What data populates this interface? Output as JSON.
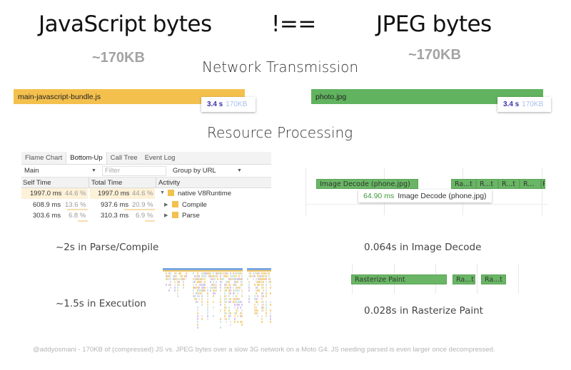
{
  "headings": {
    "left_title": "JavaScript bytes",
    "operator": "!==",
    "right_title": "JPEG bytes",
    "left_size": "~170KB",
    "right_size": "~170KB"
  },
  "network": {
    "title": "Network Transmission",
    "js": {
      "filename": "main-javascript-bundle.js",
      "time": "3.4 s",
      "size": "170KB",
      "color": "#f4c04d"
    },
    "jpg": {
      "filename": "photo.jpg",
      "time": "3.4 s",
      "size": "170KB",
      "color": "#61b35f"
    }
  },
  "processing": {
    "title": "Resource Processing"
  },
  "devtools": {
    "tabs": [
      {
        "label": "Flame Chart",
        "active": false
      },
      {
        "label": "Bottom-Up",
        "active": true
      },
      {
        "label": "Call Tree",
        "active": false
      },
      {
        "label": "Event Log",
        "active": false
      }
    ],
    "thread_select": "Main",
    "filter_placeholder": "Filter",
    "group_select": "Group by URL",
    "columns": [
      "Self Time",
      "Total Time",
      "Activity"
    ],
    "rows": [
      {
        "self_time": "1997.0 ms",
        "self_pct": "44.6 %",
        "total_time": "1997.0 ms",
        "total_pct": "44.6 %",
        "activity": "native V8Runtime",
        "expanded": true,
        "self_fraction": 1.0,
        "total_fraction": 1.0
      },
      {
        "self_time": "608.9 ms",
        "self_pct": "13.6 %",
        "total_time": "937.6 ms",
        "total_pct": "20.9 %",
        "activity": "Compile",
        "expanded": false,
        "self_fraction": 0.305,
        "total_fraction": 0.469
      },
      {
        "self_time": "303.6 ms",
        "self_pct": "6.8 %",
        "total_time": "310.3 ms",
        "total_pct": "6.9 %",
        "activity": "Parse",
        "expanded": false,
        "self_fraction": 0.152,
        "total_fraction": 0.155
      }
    ]
  },
  "js_captions": {
    "parse_compile": "~2s in Parse/Compile",
    "execution": "~1.5s in Execution"
  },
  "image_decode": {
    "main_label": "Image Decode (phone.jpg)",
    "small_labels": [
      "Ra...t",
      "R...t",
      "R...t",
      "R...",
      "R"
    ],
    "tooltip_time": "64.90 ms",
    "tooltip_label": "Image Decode (phone.jpg)",
    "caption": "0.064s in Image Decode"
  },
  "rasterize": {
    "main_label": "Rasterize Paint",
    "small_labels": [
      "Ra...t",
      "Ra...t"
    ],
    "caption": "0.028s in Rasterize Paint"
  },
  "footer": "@addyosmani - 170KB of (compressed) JS vs. JPEG bytes over a slow 3G network on a Moto G4. JS needing parsed is even larger once decompressed."
}
